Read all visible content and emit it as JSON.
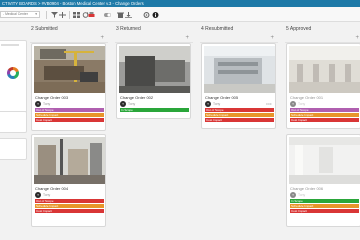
{
  "breadcrumb": "CTIVITY BOARDS > #VB0904 - Boston Medical Center v.3 - Change Orders",
  "toolbar": {
    "select_value": "- Medical Center",
    "icons": [
      "filter-icon",
      "add-icon",
      "grid-icon",
      "refresh-icon",
      "print-icon",
      "toggle-icon",
      "delete-icon",
      "download-icon",
      "settings-icon",
      "info-icon"
    ]
  },
  "colors": {
    "brand": "#1e7aa8",
    "tag_purple": "#b05fb0",
    "tag_orange": "#e8952b",
    "tag_red": "#d93636",
    "tag_green": "#2aa63a"
  },
  "columns": [
    {
      "title": "2 Submitted",
      "cards": [
        {
          "title": "Change Order 003",
          "user": "Tony",
          "tags": [
            {
              "label": "Out of Scope",
              "color": "#b05fb0"
            },
            {
              "label": "Schedule Impact",
              "color": "#e8952b"
            },
            {
              "label": "Cost Impact",
              "color": "#d93636"
            }
          ]
        },
        {
          "title": "Change Order 004",
          "user": "Tony",
          "tags": [
            {
              "label": "Out of Scope",
              "color": "#d93636"
            },
            {
              "label": "Schedule Impact",
              "color": "#e8952b"
            },
            {
              "label": "Cost Impact",
              "color": "#d93636"
            }
          ]
        }
      ]
    },
    {
      "title": "3 Returned",
      "cards": [
        {
          "title": "Change Order 002",
          "user": "Tony",
          "tags": [
            {
              "label": "In Scope",
              "color": "#2aa63a"
            }
          ]
        }
      ]
    },
    {
      "title": "4 Resubmitted",
      "cards": [
        {
          "title": "Change Order 005",
          "user": "Tony",
          "tags": [
            {
              "label": "Out of Scope",
              "color": "#d93636"
            },
            {
              "label": "Schedule Impact",
              "color": "#e8952b"
            },
            {
              "label": "Cost Impact",
              "color": "#d93636"
            }
          ]
        }
      ]
    },
    {
      "title": "5 Approved",
      "cards": [
        {
          "title": "Change Order 001",
          "user": "Tony",
          "tags": [
            {
              "label": "Out of Scope",
              "color": "#b05fb0"
            },
            {
              "label": "Schedule Impact",
              "color": "#e8952b"
            },
            {
              "label": "Cost Impact",
              "color": "#d93636"
            }
          ]
        },
        {
          "title": "Change Order 006",
          "user": "Tony",
          "tags": [
            {
              "label": "In Scope",
              "color": "#2aa63a"
            },
            {
              "label": "Schedule Impact",
              "color": "#e8952b"
            },
            {
              "label": "Cost Impact",
              "color": "#d93636"
            }
          ]
        }
      ]
    }
  ]
}
